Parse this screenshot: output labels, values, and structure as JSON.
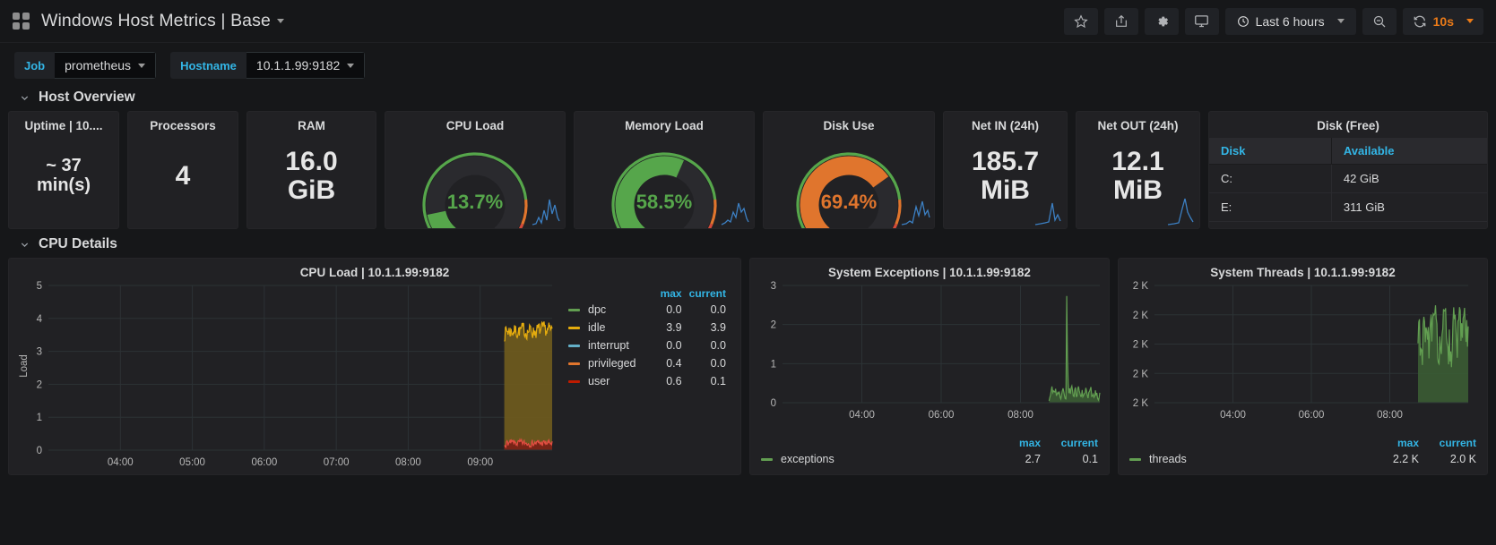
{
  "navbar": {
    "logo_icon": "grid-icon",
    "title": "Windows Host Metrics | Base",
    "star_icon": "star-icon",
    "share_icon": "share-icon",
    "settings_icon": "gear-icon",
    "tv_icon": "monitor-icon",
    "time_range": "Last 6 hours",
    "time_icon": "clock-icon",
    "zoom_out_icon": "zoom-out-icon",
    "refresh_icon": "refresh-icon",
    "refresh_interval": "10s"
  },
  "submenu": {
    "variables": [
      {
        "label": "Job",
        "value": "prometheus"
      },
      {
        "label": "Hostname",
        "value": "10.1.1.99:9182"
      }
    ]
  },
  "rows": [
    {
      "title": "Host Overview"
    },
    {
      "title": "CPU Details"
    }
  ],
  "host_overview": {
    "uptime": {
      "title": "Uptime | 10....",
      "value": "~  37\nmin(s)",
      "color": "#e6e6e6"
    },
    "processors": {
      "title": "Processors",
      "value": "4",
      "color": "#e6e6e6"
    },
    "ram": {
      "title": "RAM",
      "value": "16.0\nGiB",
      "color": "#e6e6e6"
    },
    "cpu_load": {
      "title": "CPU Load",
      "value": "13.7%",
      "percent": 13.7,
      "color": "#56a64b"
    },
    "memory_load": {
      "title": "Memory Load",
      "value": "58.5%",
      "percent": 58.5,
      "color": "#56a64b"
    },
    "disk_use": {
      "title": "Disk Use",
      "value": "69.4%",
      "percent": 69.4,
      "color": "#e0752d"
    },
    "net_in": {
      "title": "Net IN (24h)",
      "value": "185.7\nMiB",
      "color": "#e6e6e6"
    },
    "net_out": {
      "title": "Net OUT (24h)",
      "value": "12.1\nMiB",
      "color": "#e6e6e6"
    },
    "disk_free": {
      "title": "Disk (Free)",
      "columns": [
        "Disk",
        "Available"
      ],
      "rows": [
        {
          "disk": "C:",
          "available": "42 GiB"
        },
        {
          "disk": "E:",
          "available": "311 GiB"
        }
      ]
    }
  },
  "chart_data": [
    {
      "id": "cpu_load_graph",
      "type": "area",
      "title": "CPU Load | 10.1.1.99:9182",
      "xlabel": "",
      "ylabel": "Load",
      "ylim": [
        0,
        5
      ],
      "yticks": [
        "0",
        "1",
        "2",
        "3",
        "4",
        "5"
      ],
      "xticks": [
        "04:00",
        "05:00",
        "06:00",
        "07:00",
        "08:00",
        "09:00"
      ],
      "grid": true,
      "stacked": true,
      "legend_position": "right",
      "legend_columns": [
        "max",
        "current"
      ],
      "series": [
        {
          "name": "dpc",
          "color": "#629e51",
          "max": "0.0",
          "current": "0.0"
        },
        {
          "name": "idle",
          "color": "#e5ac0e",
          "max": "3.9",
          "current": "3.9"
        },
        {
          "name": "interrupt",
          "color": "#64b0c8",
          "max": "0.0",
          "current": "0.0"
        },
        {
          "name": "privileged",
          "color": "#e0752d",
          "max": "0.4",
          "current": "0.0"
        },
        {
          "name": "user",
          "color": "#bf1b00",
          "max": "0.6",
          "current": "0.1"
        }
      ],
      "data_window_note": "data present only after ~08:50"
    },
    {
      "id": "system_exceptions_graph",
      "type": "area",
      "title": "System Exceptions | 10.1.1.99:9182",
      "xlabel": "",
      "ylabel": "",
      "ylim": [
        0,
        3
      ],
      "yticks": [
        "0",
        "1",
        "2",
        "3"
      ],
      "xticks": [
        "04:00",
        "06:00",
        "08:00"
      ],
      "grid": true,
      "legend_position": "bottom",
      "legend_columns": [
        "max",
        "current"
      ],
      "series": [
        {
          "name": "exceptions",
          "color": "#629e51",
          "max": "2.7",
          "current": "0.1"
        }
      ]
    },
    {
      "id": "system_threads_graph",
      "type": "area",
      "title": "System Threads | 10.1.1.99:9182",
      "xlabel": "",
      "ylabel": "",
      "yticks": [
        "2 K",
        "2 K",
        "2 K",
        "2 K",
        "2 K"
      ],
      "xticks": [
        "04:00",
        "06:00",
        "08:00"
      ],
      "grid": true,
      "legend_position": "bottom",
      "legend_columns": [
        "max",
        "current"
      ],
      "series": [
        {
          "name": "threads",
          "color": "#629e51",
          "max": "2.2 K",
          "current": "2.0 K"
        }
      ]
    }
  ],
  "colors": {
    "accent_blue": "#33b5e5",
    "orange": "#eb7b18",
    "green": "#56a64b",
    "panel_bg": "#212124",
    "page_bg": "#161719"
  }
}
